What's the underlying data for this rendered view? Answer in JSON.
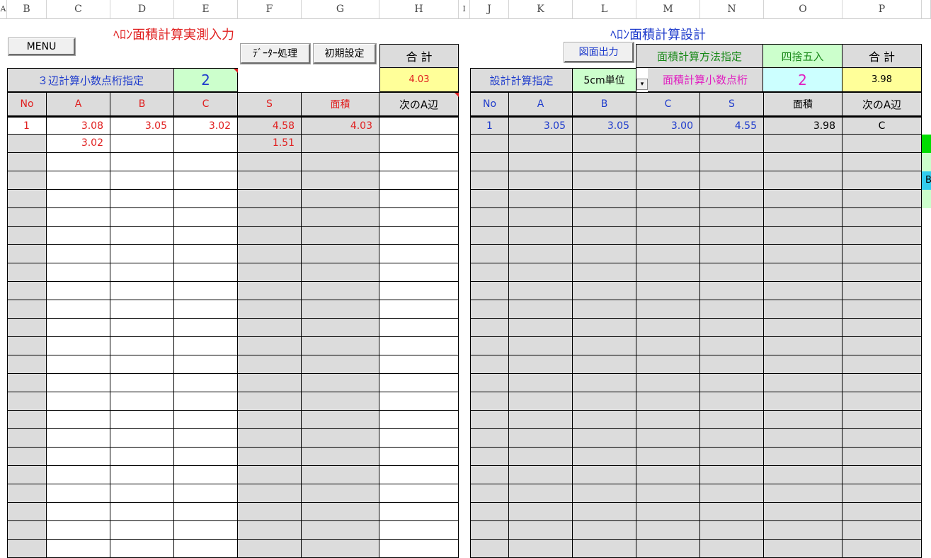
{
  "column_headers": [
    "A",
    "B",
    "C",
    "D",
    "E",
    "F",
    "G",
    "H",
    "I",
    "J",
    "K",
    "L",
    "M",
    "N",
    "O",
    "P"
  ],
  "left": {
    "title": "ﾍﾛﾝ面積計算実測入力",
    "menu_button": "MENU",
    "data_button": "ﾃﾞｰﾀｰ処理",
    "init_button": "初期設定",
    "total_label": "合 計",
    "total_value": "4.03",
    "decimal_label": "３辺計算小数点桁指定",
    "decimal_value": "2",
    "headers": [
      "No",
      "A",
      "B",
      "C",
      "S",
      "面積",
      "次のA辺"
    ],
    "rows": [
      [
        "1",
        "3.08",
        "3.05",
        "3.02",
        "4.58",
        "4.03",
        ""
      ],
      [
        "",
        "3.02",
        "",
        "",
        "1.51",
        "",
        ""
      ]
    ]
  },
  "right": {
    "title": "ﾍﾛﾝ面積計算設計",
    "drawing_button": "図面出力",
    "method_label": "面積計算方法指定",
    "method_value": "四捨五入",
    "total_label": "合 計",
    "total_value": "3.98",
    "design_label": "設計計算指定",
    "unit_value": "5cm単位",
    "decimal_label": "面積計算小数点桁",
    "decimal_value": "2",
    "headers": [
      "No",
      "A",
      "B",
      "C",
      "S",
      "面積",
      "次のA辺"
    ],
    "rows": [
      [
        "1",
        "3.05",
        "3.05",
        "3.00",
        "4.55",
        "3.98",
        "C"
      ]
    ]
  },
  "edge_text": "B",
  "colors": {
    "red": "#e02020",
    "blue": "#1f3ccc",
    "gray_cell": "#dcdcdc",
    "yellow": "#ffff99",
    "light_green": "#ccffcc",
    "light_cyan": "#ccffff",
    "magenta": "#e020c0",
    "green_text": "#1a8a1a",
    "bright_green": "#00dd00",
    "cyan": "#33ccee"
  }
}
